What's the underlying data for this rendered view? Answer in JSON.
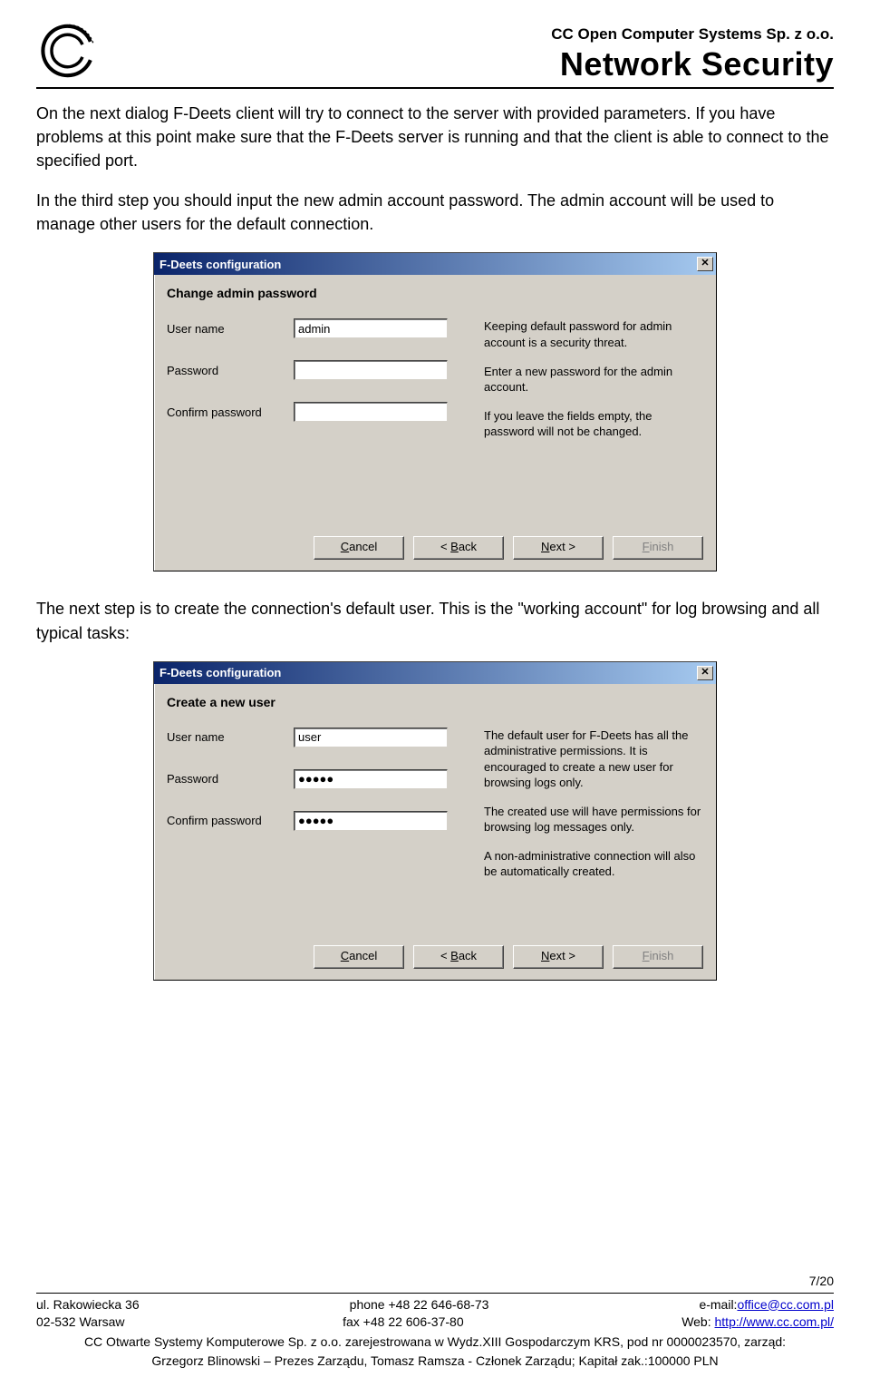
{
  "header": {
    "company": "CC Open Computer Systems Sp. z o.o.",
    "product": "Network Security"
  },
  "para1": "On the next dialog F-Deets client will try to connect to the server with provided parameters. If you have problems at this point make sure that the F-Deets server is running and that the client is able to connect to the specified port.",
  "para2": "In the third step you should input the new admin account password. The admin account will be used to manage other users for the default connection.",
  "para3": "The next step is to create the connection's default user. This is the \"working account\" for log browsing and all typical tasks:",
  "dialog1": {
    "title": "F-Deets configuration",
    "heading": "Change admin password",
    "user_label": "User name",
    "user_value": "admin",
    "pass_label": "Password",
    "pass_value": "",
    "confirm_label": "Confirm password",
    "confirm_value": "",
    "info1": "Keeping default password for admin account is a security threat.",
    "info2": "Enter a new password for the admin account.",
    "info3": "If you leave the fields empty, the password will not be changed."
  },
  "dialog2": {
    "title": "F-Deets configuration",
    "heading": "Create a new user",
    "user_label": "User name",
    "user_value": "user",
    "pass_label": "Password",
    "pass_value": "●●●●●",
    "confirm_label": "Confirm password",
    "confirm_value": "●●●●●",
    "info1": "The default user for F-Deets has all the administrative permissions. It is encouraged to create a new user for browsing logs only.",
    "info2": "The created use will have permissions for browsing log messages only.",
    "info3": "A non-administrative connection will also be automatically created."
  },
  "buttons": {
    "cancel": "Cancel",
    "back": "< Back",
    "next": "Next >",
    "finish": "Finish"
  },
  "footer": {
    "pagenum": "7/20",
    "addr1": "ul.  Rakowiecka 36",
    "addr2": "02-532 Warsaw",
    "phone": "phone +48 22 646-68-73",
    "fax": "fax +48 22 606-37-80",
    "email_label": "e-mail:",
    "email_link": "office@cc.com.pl",
    "web_label": "Web: ",
    "web_link": "http://www.cc.com.pl/",
    "legal1": "CC Otwarte Systemy Komputerowe Sp. z o.o. zarejestrowana w Wydz.XIII Gospodarczym KRS, pod nr 0000023570, zarząd:",
    "legal2": "Grzegorz Blinowski – Prezes Zarządu, Tomasz Ramsza - Członek Zarządu; Kapitał zak.:100000 PLN"
  }
}
